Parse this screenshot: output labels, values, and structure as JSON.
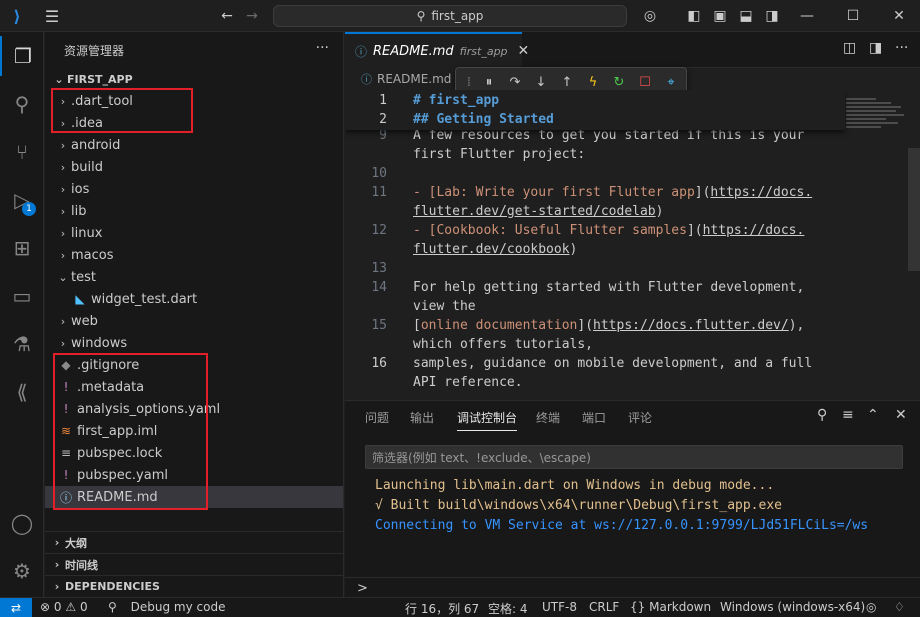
{
  "titlebar": {
    "search_text": "first_app"
  },
  "activity": {
    "debug_badge": "1"
  },
  "sidebar": {
    "title": "资源管理器",
    "root": "FIRST_APP",
    "items": [
      {
        "label": ".dart_tool",
        "type": "folder"
      },
      {
        "label": ".idea",
        "type": "folder"
      },
      {
        "label": "android",
        "type": "folder"
      },
      {
        "label": "build",
        "type": "folder"
      },
      {
        "label": "ios",
        "type": "folder"
      },
      {
        "label": "lib",
        "type": "folder"
      },
      {
        "label": "linux",
        "type": "folder"
      },
      {
        "label": "macos",
        "type": "folder"
      },
      {
        "label": "test",
        "type": "folder-open"
      },
      {
        "label": "widget_test.dart",
        "type": "dart"
      },
      {
        "label": "web",
        "type": "folder"
      },
      {
        "label": "windows",
        "type": "folder"
      },
      {
        "label": ".gitignore",
        "type": "git"
      },
      {
        "label": ".metadata",
        "type": "meta"
      },
      {
        "label": "analysis_options.yaml",
        "type": "yaml"
      },
      {
        "label": "first_app.iml",
        "type": "iml"
      },
      {
        "label": "pubspec.lock",
        "type": "lock"
      },
      {
        "label": "pubspec.yaml",
        "type": "yaml"
      },
      {
        "label": "README.md",
        "type": "info"
      }
    ],
    "sections": [
      "大纲",
      "时间线",
      "DEPENDENCIES"
    ]
  },
  "editor": {
    "tab_name": "README.md",
    "tab_path": "first_app",
    "breadcrumb": "README.md",
    "sticky": [
      {
        "ln": "1",
        "text": "# first_app"
      },
      {
        "ln": "2",
        "text": "## Getting Started"
      }
    ],
    "lines": [
      {
        "ln": "9",
        "parts": [
          {
            "t": "A few resources to get you started if this is your",
            "c": ""
          }
        ]
      },
      {
        "ln": "",
        "parts": [
          {
            "t": "first Flutter project:",
            "c": ""
          }
        ]
      },
      {
        "ln": "10",
        "parts": []
      },
      {
        "ln": "11",
        "parts": [
          {
            "t": "- [",
            "c": "md-link"
          },
          {
            "t": "Lab: Write your first Flutter app",
            "c": "md-link"
          },
          {
            "t": "](",
            "c": ""
          },
          {
            "t": "https://docs.",
            "c": "md-url"
          }
        ]
      },
      {
        "ln": "",
        "parts": [
          {
            "t": "flutter.dev/get-started/codelab",
            "c": "md-url"
          },
          {
            "t": ")",
            "c": ""
          }
        ]
      },
      {
        "ln": "12",
        "parts": [
          {
            "t": "- [",
            "c": "md-link"
          },
          {
            "t": "Cookbook: Useful Flutter samples",
            "c": "md-link"
          },
          {
            "t": "](",
            "c": ""
          },
          {
            "t": "https://docs.",
            "c": "md-url"
          }
        ]
      },
      {
        "ln": "",
        "parts": [
          {
            "t": "flutter.dev/cookbook",
            "c": "md-url"
          },
          {
            "t": ")",
            "c": ""
          }
        ]
      },
      {
        "ln": "13",
        "parts": []
      },
      {
        "ln": "14",
        "parts": [
          {
            "t": "For help getting started with Flutter development,",
            "c": ""
          }
        ]
      },
      {
        "ln": "",
        "parts": [
          {
            "t": "view the",
            "c": ""
          }
        ]
      },
      {
        "ln": "15",
        "parts": [
          {
            "t": "[",
            "c": ""
          },
          {
            "t": "online documentation",
            "c": "md-link"
          },
          {
            "t": "](",
            "c": ""
          },
          {
            "t": "https://docs.flutter.dev/",
            "c": "md-url"
          },
          {
            "t": "),",
            "c": ""
          }
        ]
      },
      {
        "ln": "",
        "parts": [
          {
            "t": "which offers tutorials,",
            "c": ""
          }
        ]
      },
      {
        "ln": "16",
        "parts": [
          {
            "t": "samples, guidance on mobile development, and a full",
            "c": ""
          }
        ]
      },
      {
        "ln": "",
        "parts": [
          {
            "t": "API reference.",
            "c": ""
          }
        ]
      },
      {
        "ln": "17",
        "parts": []
      }
    ]
  },
  "panel": {
    "tabs": [
      "问题",
      "输出",
      "调试控制台",
      "终端",
      "端口",
      "评论"
    ],
    "active_tab": 2,
    "filter_placeholder": "筛选器(例如 text、!exclude、\\escape)",
    "console": [
      {
        "text": "Launching lib\\main.dart on Windows in debug mode...",
        "color": "#e2c08d"
      },
      {
        "text": "√ Built build\\windows\\x64\\runner\\Debug\\first_app.exe",
        "color": "#e2c08d"
      },
      {
        "text": "Connecting to VM Service at ws://127.0.0.1:9799/LJd51FLCiLs=/ws",
        "color": "#3794ff"
      }
    ],
    "prompt": ">"
  },
  "statusbar": {
    "errors": "0",
    "warnings": "0",
    "debug": "Debug my code",
    "position": "行 16，列 67",
    "spaces": "空格: 4",
    "encoding": "UTF-8",
    "eol": "CRLF",
    "language": "Markdown",
    "device": "Windows (windows-x64)"
  }
}
